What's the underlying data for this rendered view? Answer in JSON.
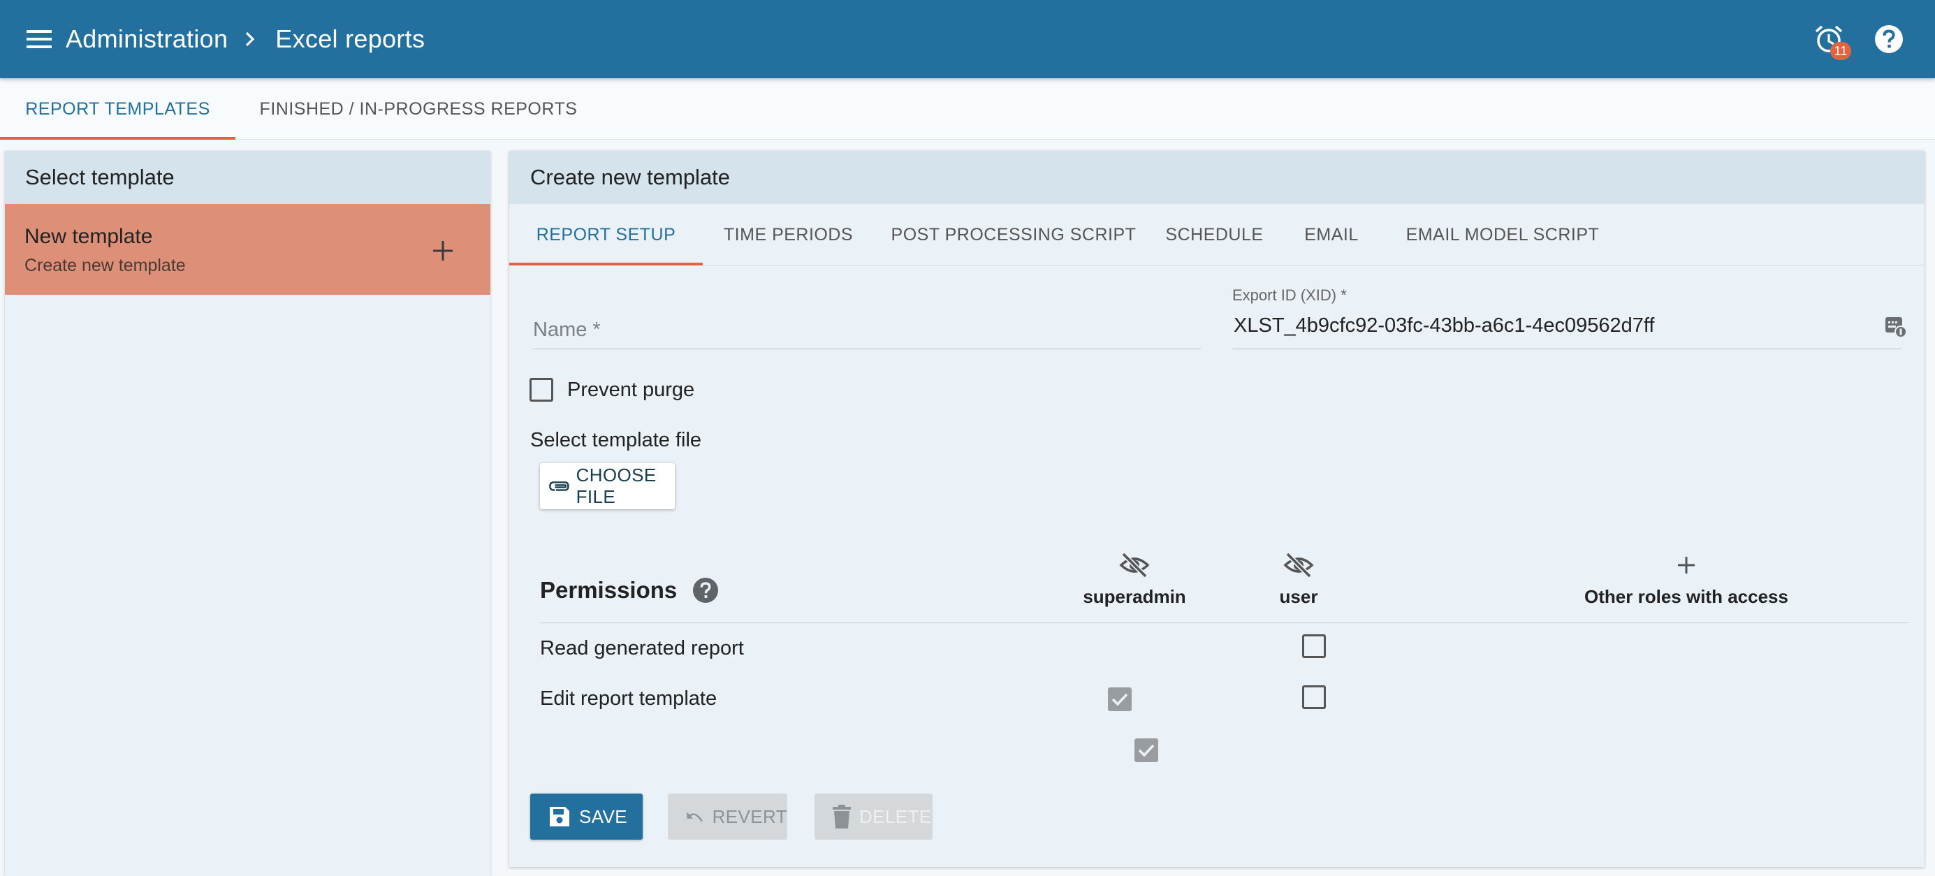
{
  "header": {
    "breadcrumb": [
      "Administration",
      "Excel reports"
    ],
    "alarm_count": "11",
    "icons": [
      "menu-icon",
      "chevron-right-icon",
      "alarm-clock-icon",
      "help-icon"
    ]
  },
  "main_tabs": [
    {
      "label": "REPORT TEMPLATES",
      "active": true
    },
    {
      "label": "FINISHED / IN-PROGRESS REPORTS",
      "active": false
    }
  ],
  "left_panel": {
    "title": "Select template",
    "items": [
      {
        "title": "New template",
        "subtitle": "Create new template"
      }
    ]
  },
  "right_panel": {
    "title": "Create new template",
    "tabs": [
      {
        "label": "REPORT SETUP",
        "active": true
      },
      {
        "label": "TIME PERIODS",
        "active": false
      },
      {
        "label": "POST PROCESSING SCRIPT",
        "active": false
      },
      {
        "label": "SCHEDULE",
        "active": false
      },
      {
        "label": "EMAIL",
        "active": false
      },
      {
        "label": "EMAIL MODEL SCRIPT",
        "active": false
      }
    ],
    "name_field": {
      "placeholder": "Name *",
      "value": ""
    },
    "xid_field": {
      "label": "Export ID (XID) *",
      "value": "XLST_4b9cfc92-03fc-43bb-a6c1-4ec09562d7ff"
    },
    "prevent_purge": {
      "label": "Prevent purge",
      "checked": false
    },
    "template_file": {
      "label": "Select template file",
      "button": "CHOOSE FILE"
    },
    "permissions": {
      "title": "Permissions",
      "roles": [
        "superadmin",
        "user",
        "Other roles with access"
      ],
      "rows": [
        {
          "label": "Read generated report",
          "superadmin": true,
          "user": false
        },
        {
          "label": "Edit report template",
          "superadmin": true,
          "user": false
        }
      ]
    },
    "actions": {
      "save": "SAVE",
      "revert": "REVERT",
      "delete": "DELETE"
    }
  },
  "colors": {
    "primary": "#23709e",
    "accent": "#e0643f",
    "selected_item": "#de8f78",
    "panel_header": "#d4e3ec",
    "panel_bg": "#eaf1f7"
  }
}
